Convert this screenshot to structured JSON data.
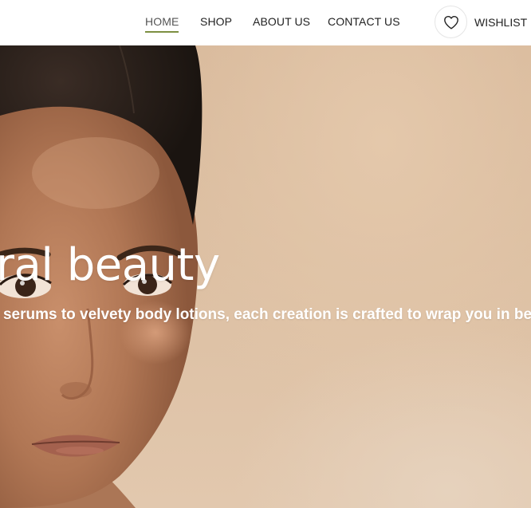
{
  "nav": {
    "items": [
      {
        "label": "HOME",
        "active": true
      },
      {
        "label": "SHOP",
        "active": false
      },
      {
        "label": "ABOUT US",
        "active": false
      },
      {
        "label": "CONTACT US",
        "active": false
      }
    ],
    "wishlist_label": "WISHLIST",
    "wishlist_icon": "heart-outline-icon",
    "active_underline_color": "#7d8f42"
  },
  "hero": {
    "title": "ural beauty",
    "subtitle": "ir serums to velvety body lotions, each creation is crafted to wrap you in bea"
  }
}
